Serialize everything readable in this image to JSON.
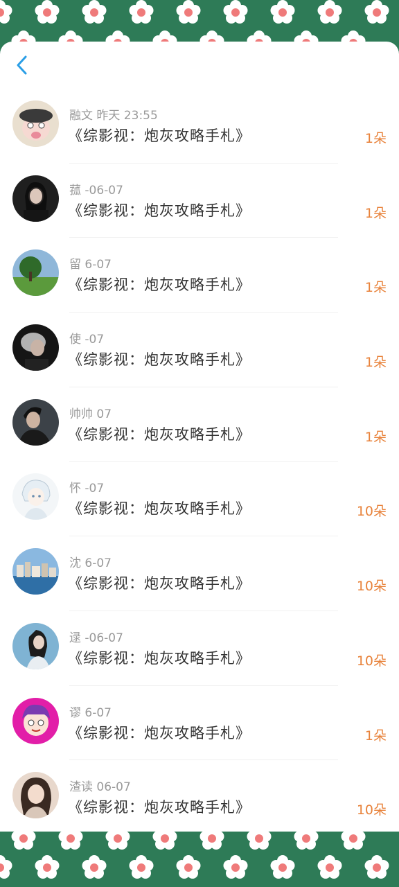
{
  "colors": {
    "decoration_green": "#2e7b57",
    "accent_back": "#2a9ee6",
    "amount_orange": "#e8823a",
    "meta_gray": "#9a9a9a",
    "title_dark": "#333333"
  },
  "header": {
    "back_icon": "chevron-left-icon"
  },
  "records": [
    {
      "meta": "融文 昨天 23:55",
      "title": "《综影视：炮灰攻略手札》",
      "amount": "1朵",
      "avatar": "cartoon-avatar"
    },
    {
      "meta": "菰 -06-07",
      "title": "《综影视：炮灰攻略手札》",
      "amount": "1朵",
      "avatar": "girl-portrait-avatar"
    },
    {
      "meta": "留 6-07",
      "title": "《综影视：炮灰攻略手札》",
      "amount": "1朵",
      "avatar": "tree-landscape-avatar"
    },
    {
      "meta": "使 -07",
      "title": "《综影视：炮灰攻略手札》",
      "amount": "1朵",
      "avatar": "smoke-portrait-avatar"
    },
    {
      "meta": "帅帅 07",
      "title": "《综影视：炮灰攻略手札》",
      "amount": "1朵",
      "avatar": "boy-portrait-avatar"
    },
    {
      "meta": "怀 -07",
      "title": "《综影视：炮灰攻略手札》",
      "amount": "10朵",
      "avatar": "anime-avatar"
    },
    {
      "meta": "沈 6-07",
      "title": "《综影视：炮灰攻略手札》",
      "amount": "10朵",
      "avatar": "city-waterfront-avatar"
    },
    {
      "meta": "逯 -06-07",
      "title": "《综影视：炮灰攻略手札》",
      "amount": "10朵",
      "avatar": "girl-blue-avatar"
    },
    {
      "meta": "谬 6-07",
      "title": "《综影视：炮灰攻略手札》",
      "amount": "1朵",
      "avatar": "purple-cartoon-avatar"
    },
    {
      "meta": "渣读 06-07",
      "title": "《综影视：炮灰攻略手札》",
      "amount": "10朵",
      "avatar": "woman-portrait-avatar"
    }
  ]
}
